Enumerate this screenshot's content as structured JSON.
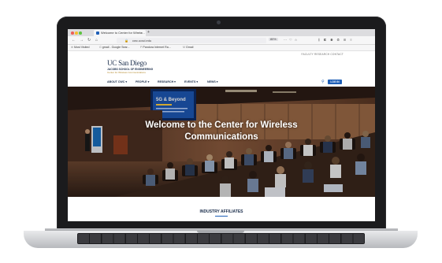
{
  "browser": {
    "tab_title": "Welcome to Center for Wirele...",
    "tab_close": "×",
    "new_tab": "+",
    "nav": {
      "back": "←",
      "forward": "→",
      "reload": "↻",
      "home": "⌂"
    },
    "url": "cwc.ucsd.edu",
    "zoom": "80%",
    "url_actions": "⋯ ♡ ☆",
    "extensions": "⫼ ◧ ◉ ◎ ⊞ ≡",
    "bookmarks": [
      {
        "icon": "⊕",
        "label": "Most Visited"
      },
      {
        "icon": "G",
        "label": "gmail - Google Sear..."
      },
      {
        "icon": "P",
        "label": "Pandora Internet Ra..."
      },
      {
        "icon": "M",
        "label": "Gmail"
      }
    ]
  },
  "site": {
    "utility_links": "FACULTY   RESEARCH   CONTACT",
    "logo": {
      "university": "UC San Diego",
      "school": "JACOBS SCHOOL OF ENGINEERING",
      "center": "Center for Wireless Communications"
    },
    "nav": [
      {
        "label": "ABOUT CWC ▾"
      },
      {
        "label": "PEOPLE ▾"
      },
      {
        "label": "RESEARCH ▾"
      },
      {
        "label": "EVENTS ▾"
      },
      {
        "label": "NEWS ▾"
      }
    ],
    "login_label": "LOG IN",
    "hero": {
      "title_line1": "Welcome to the Center for Wireless",
      "title_line2": "Communications",
      "slide_text": "5G & Beyond"
    },
    "section_heading": "INDUSTRY AFFILIATES"
  },
  "colors": {
    "brand_navy": "#182b49",
    "accent_blue": "#1f5fb7",
    "gold": "#b48a2d"
  }
}
